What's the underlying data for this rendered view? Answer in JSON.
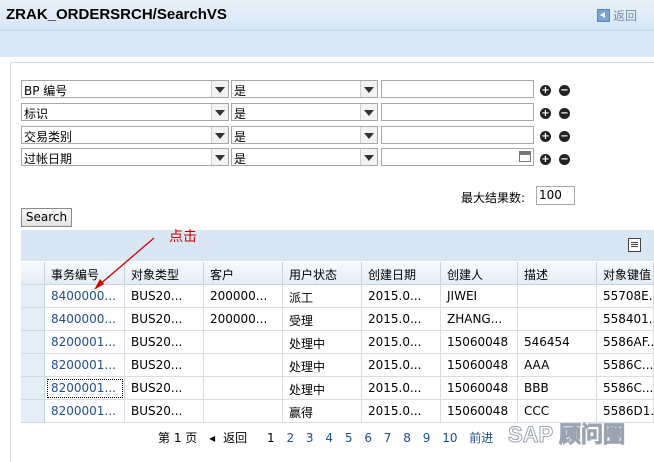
{
  "window": {
    "title": "ZRAK_ORDERSRCH/SearchVS",
    "back_label": "返回"
  },
  "criteria": [
    {
      "field": "BP 编号",
      "operator": "是",
      "value": ""
    },
    {
      "field": "标识",
      "operator": "是",
      "value": ""
    },
    {
      "field": "交易类别",
      "operator": "是",
      "value": ""
    },
    {
      "field": "过帐日期",
      "operator": "是",
      "value": ""
    }
  ],
  "max_results": {
    "label": "最大结果数:",
    "value": "100"
  },
  "search_button": "Search",
  "annotation": "点击",
  "table": {
    "columns": [
      "事务编号",
      "对象类型",
      "客户",
      "用户状态",
      "创建日期",
      "创建人",
      "描述",
      "对象键值"
    ],
    "rows": [
      [
        "8400000...",
        "BUS20...",
        "200000...",
        "派工",
        "2015.0...",
        "JIWEI",
        "",
        "55708E..."
      ],
      [
        "8400000...",
        "BUS20...",
        "200000...",
        "受理",
        "2015.0...",
        "ZHANG...",
        "",
        "558401..."
      ],
      [
        "8200001...",
        "BUS20...",
        "",
        "处理中",
        "2015.0...",
        "15060048",
        "546454",
        "5586AF..."
      ],
      [
        "8200001...",
        "BUS20...",
        "",
        "处理中",
        "2015.0...",
        "15060048",
        "AAA",
        "5586C..."
      ],
      [
        "8200001...",
        "BUS20...",
        "",
        "处理中",
        "2015.0...",
        "15060048",
        "BBB",
        "5586C..."
      ],
      [
        "8200001...",
        "BUS20...",
        "",
        "赢得",
        "2015.0...",
        "15060048",
        "CCC",
        "5586D1..."
      ]
    ]
  },
  "pager": {
    "page_label": "第 1 页",
    "back": "返回",
    "pages": [
      "1",
      "2",
      "3",
      "4",
      "5",
      "6",
      "7",
      "8",
      "9",
      "10"
    ],
    "forward": "前进"
  },
  "watermark": "SAP 顾问圈",
  "colors": {
    "link": "#1f4e8c",
    "toolbar": "#d9e6f3",
    "annotation": "#d40000"
  }
}
